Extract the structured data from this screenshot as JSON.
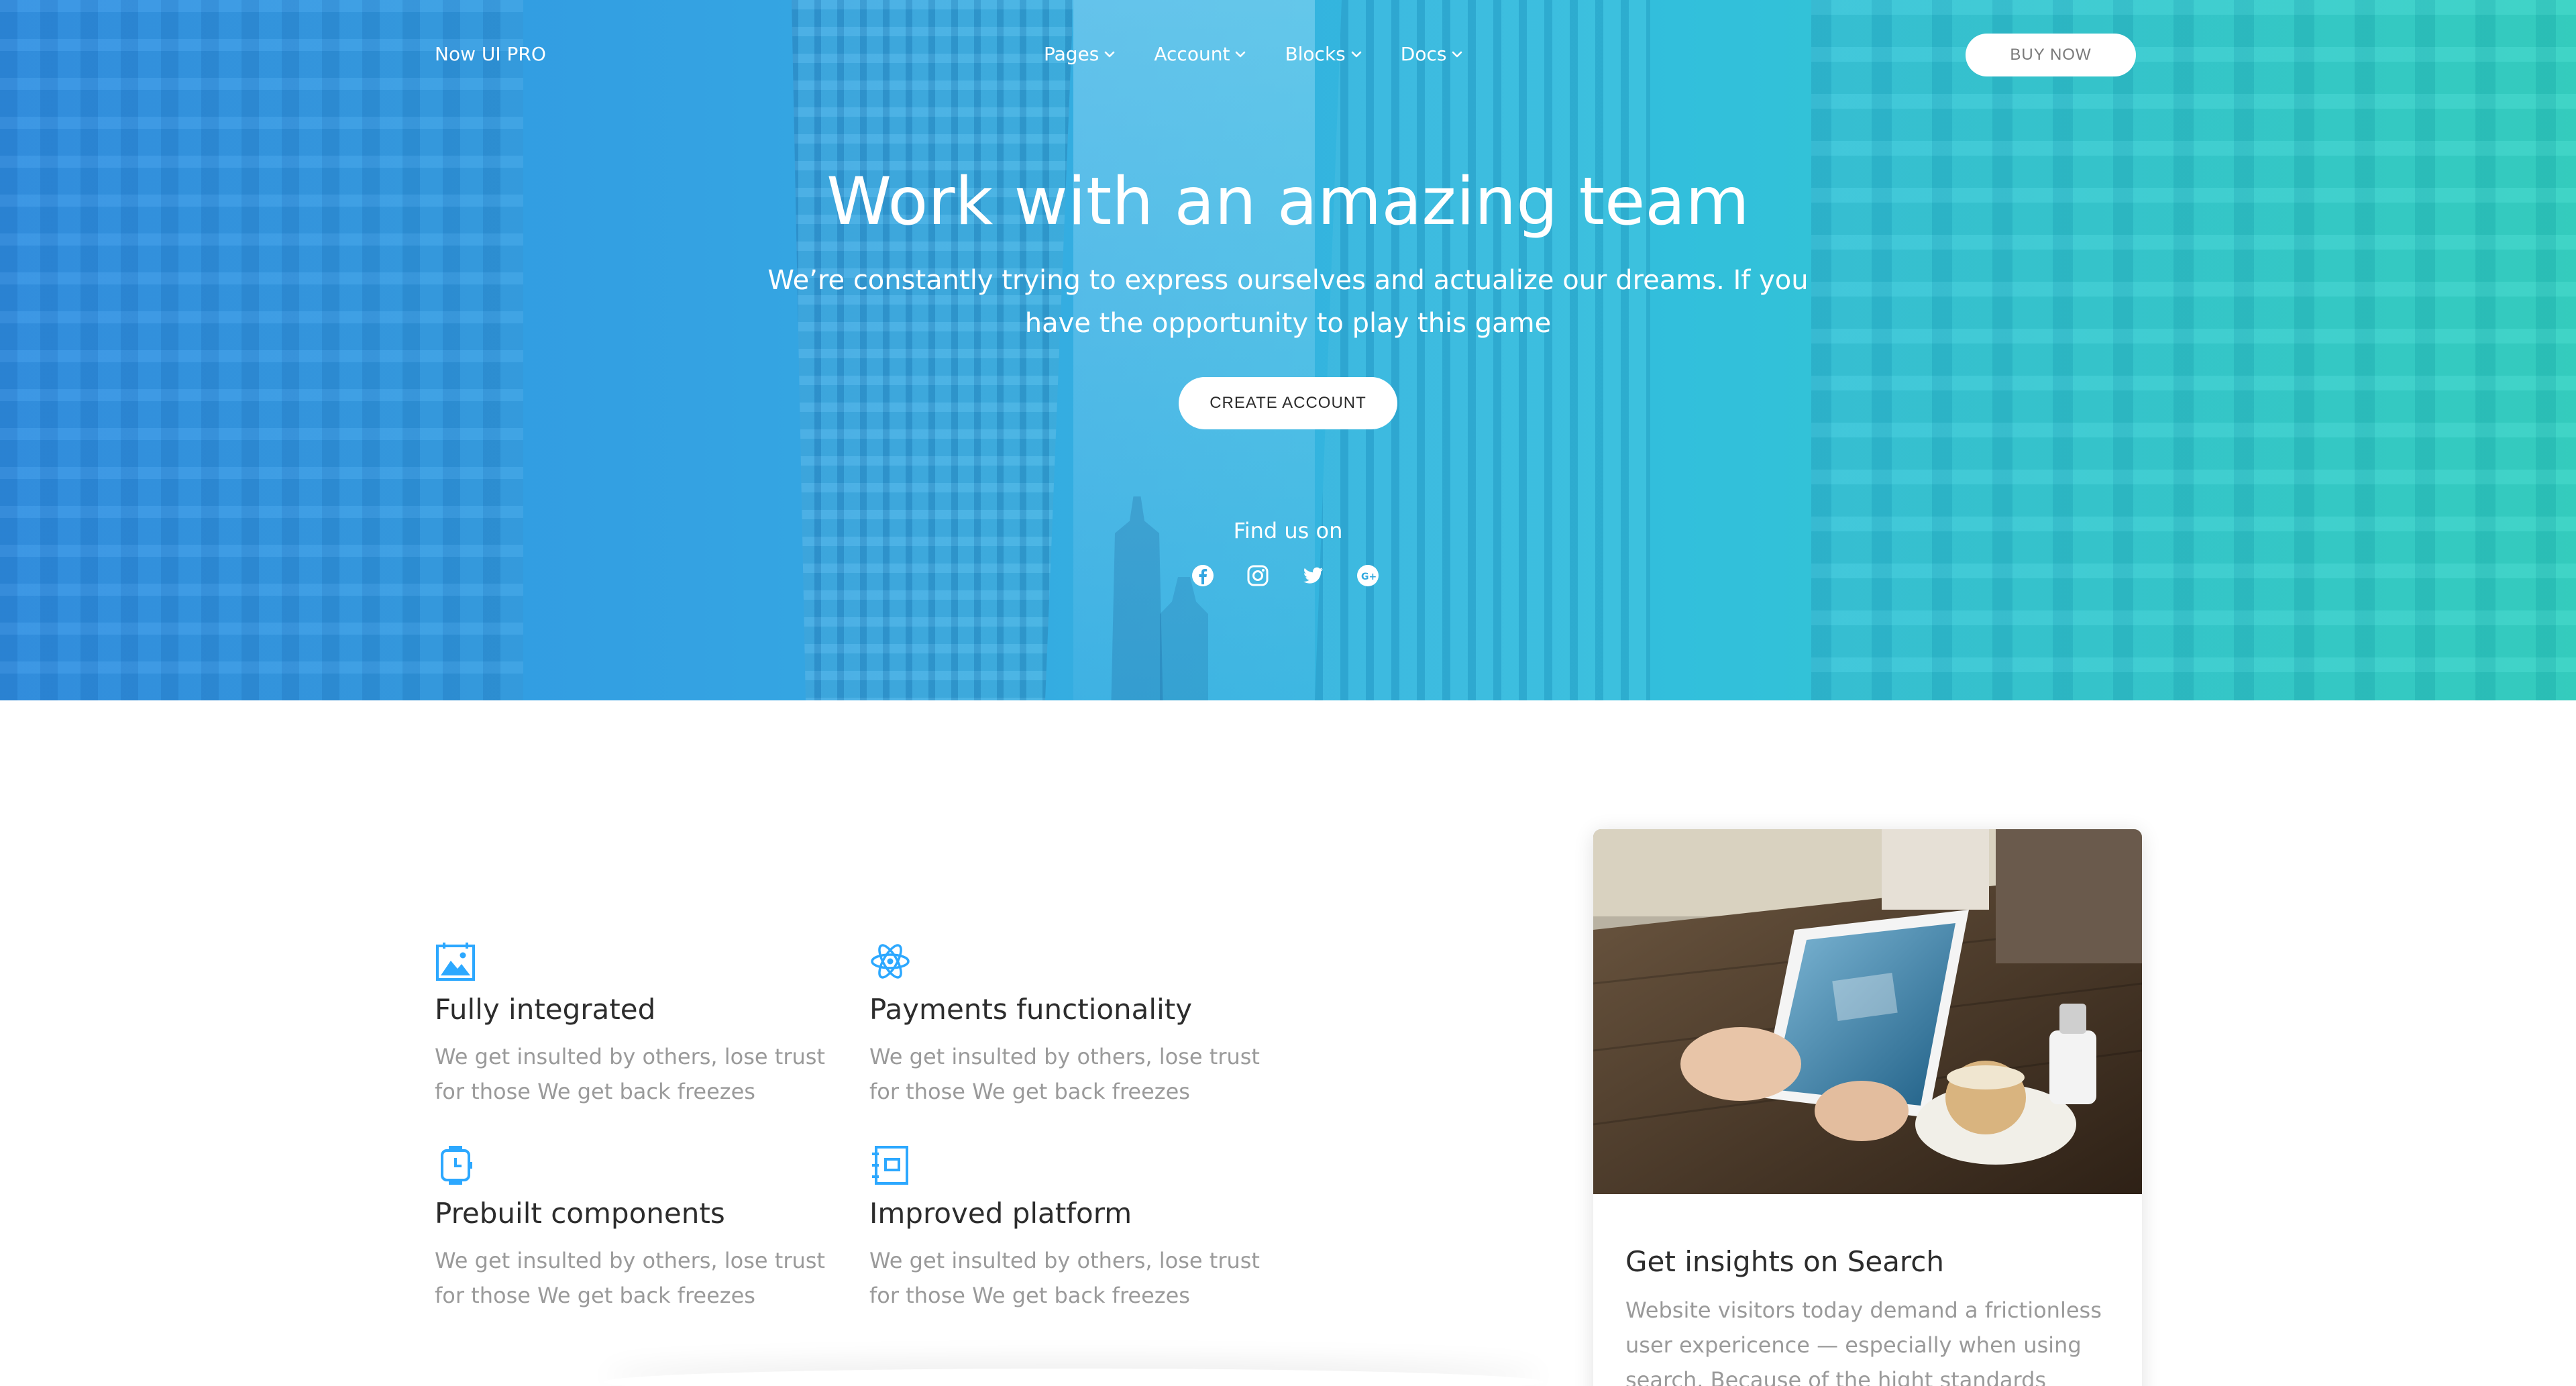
{
  "navbar": {
    "brand": "Now UI PRO",
    "items": [
      {
        "label": "Pages"
      },
      {
        "label": "Account"
      },
      {
        "label": "Blocks"
      },
      {
        "label": "Docs"
      }
    ],
    "buy_label": "BUY NOW"
  },
  "hero": {
    "title": "Work with an amazing team",
    "description": "We’re constantly trying to express ourselves and actualize our dreams. If you have the opportunity to play this game",
    "create_label": "CREATE ACCOUNT",
    "find_label": "Find us on",
    "socials": [
      "facebook-icon",
      "instagram-icon",
      "twitter-icon",
      "google-plus-icon"
    ],
    "gradient_colors": [
      "#2f8fe3",
      "#2fd1c1"
    ]
  },
  "features": [
    {
      "icon": "image-calendar-icon",
      "title": "Fully integrated",
      "description": "We get insulted by others, lose trust for those We get back freezes"
    },
    {
      "icon": "atom-icon",
      "title": "Payments functionality",
      "description": "We get insulted by others, lose trust for those We get back freezes"
    },
    {
      "icon": "watch-icon",
      "title": "Prebuilt components",
      "description": "We get insulted by others, lose trust for those We get back freezes"
    },
    {
      "icon": "notebook-icon",
      "title": "Improved platform",
      "description": "We get insulted by others, lose trust for those We get back freezes"
    }
  ],
  "card": {
    "title": "Get insights on Search",
    "description": "Website visitors today demand a frictionless user expericence — especially when using search. Because of the hight standards"
  },
  "colors": {
    "accent": "#2ca8ff",
    "heading": "#2c2c2c",
    "muted": "#9a9a9a"
  }
}
